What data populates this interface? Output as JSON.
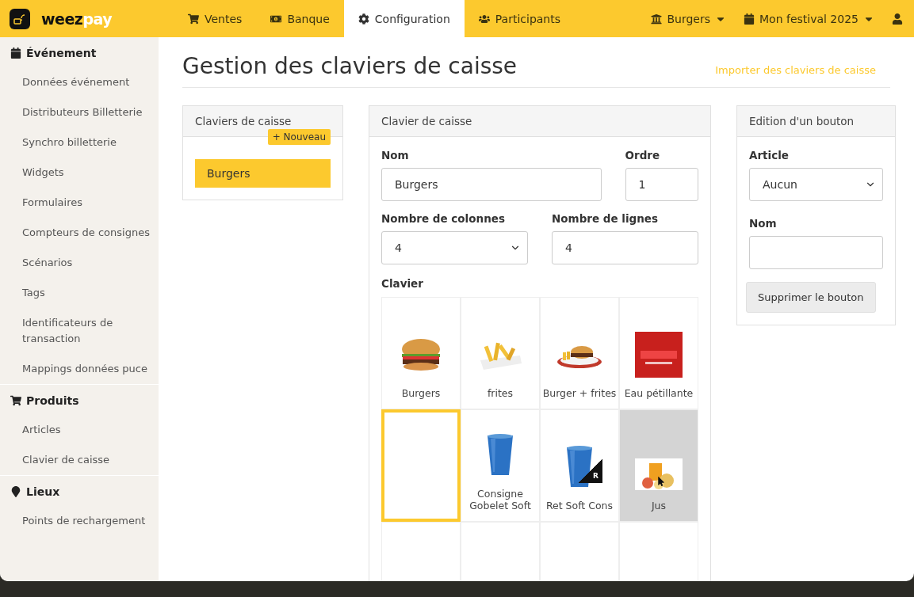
{
  "topbar": {
    "logo": {
      "weez": "weez",
      "pay": "pay"
    },
    "nav": [
      {
        "label": "Ventes",
        "selected": false
      },
      {
        "label": "Banque",
        "selected": false
      },
      {
        "label": "Configuration",
        "selected": true
      },
      {
        "label": "Participants",
        "selected": false
      }
    ],
    "right": [
      {
        "label": "Burgers"
      },
      {
        "label": "Mon festival 2025"
      }
    ]
  },
  "sidebar": [
    {
      "title": "Événement",
      "items": [
        "Données événement",
        "Distributeurs Billetterie",
        "Synchro billetterie",
        "Widgets",
        "Formulaires",
        "Compteurs de consignes",
        "Scénarios",
        "Tags",
        "Identificateurs de transaction",
        "Mappings données puce"
      ]
    },
    {
      "title": "Produits",
      "items": [
        "Articles",
        "Clavier de caisse"
      ]
    },
    {
      "title": "Lieux",
      "items": [
        "Points de rechargement"
      ]
    }
  ],
  "page": {
    "title": "Gestion des claviers de caisse",
    "import_link": "Importer des claviers de caisse"
  },
  "list_panel": {
    "title": "Claviers de caisse",
    "new_button": "+ Nouveau",
    "items": [
      {
        "label": "Burgers",
        "selected": true
      }
    ]
  },
  "editor": {
    "title": "Clavier de caisse",
    "name_label": "Nom",
    "name_value": "Burgers",
    "order_label": "Ordre",
    "order_value": "1",
    "columns_label": "Nombre de colonnes",
    "columns_value": "4",
    "rows_label": "Nombre de lignes",
    "rows_value": "4",
    "keyboard_label": "Clavier",
    "cells": [
      {
        "kind": "product",
        "label": "Burgers",
        "selected": false,
        "hovered": false
      },
      {
        "kind": "product",
        "label": "frites",
        "selected": false,
        "hovered": false
      },
      {
        "kind": "product",
        "label": "Burger + frites",
        "selected": false,
        "hovered": false
      },
      {
        "kind": "product",
        "label": "Eau pétillante",
        "selected": false,
        "hovered": false
      },
      {
        "kind": "empty",
        "selected": true,
        "hovered": false
      },
      {
        "kind": "product",
        "label": "Consigne Gobelet Soft",
        "selected": false,
        "hovered": false
      },
      {
        "kind": "product",
        "label": "Ret Soft Cons",
        "badge": "R",
        "selected": false,
        "hovered": false
      },
      {
        "kind": "product",
        "label": "Jus",
        "selected": false,
        "hovered": true
      },
      {
        "kind": "empty",
        "selected": false,
        "hovered": false
      },
      {
        "kind": "empty",
        "selected": false,
        "hovered": false
      },
      {
        "kind": "empty",
        "selected": false,
        "hovered": false
      },
      {
        "kind": "empty",
        "selected": false,
        "hovered": false
      }
    ]
  },
  "button_editor": {
    "title": "Edition d'un bouton",
    "article_label": "Article",
    "article_value": "Aucun",
    "name_label": "Nom",
    "delete_button": "Supprimer le bouton"
  }
}
